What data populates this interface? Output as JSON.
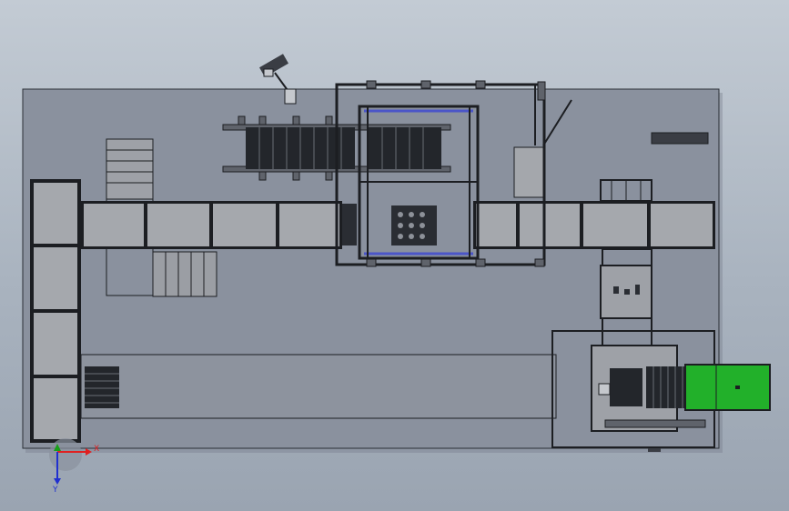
{
  "view": {
    "background_top": "#c3cbd4",
    "background_bottom": "#9aa4b1",
    "floor_color": "#8a919e",
    "line_color": "#1a1c20",
    "guard_color": "#4b55c8",
    "accent_green": "#22b02a"
  },
  "triad": {
    "x_label": "X",
    "y_label": "Y",
    "x_color": "#e02020",
    "y_color": "#18a018",
    "z_color": "#2030d0"
  },
  "icons": {
    "robot": "robot-arm-icon",
    "triad": "coordinate-triad-icon"
  }
}
